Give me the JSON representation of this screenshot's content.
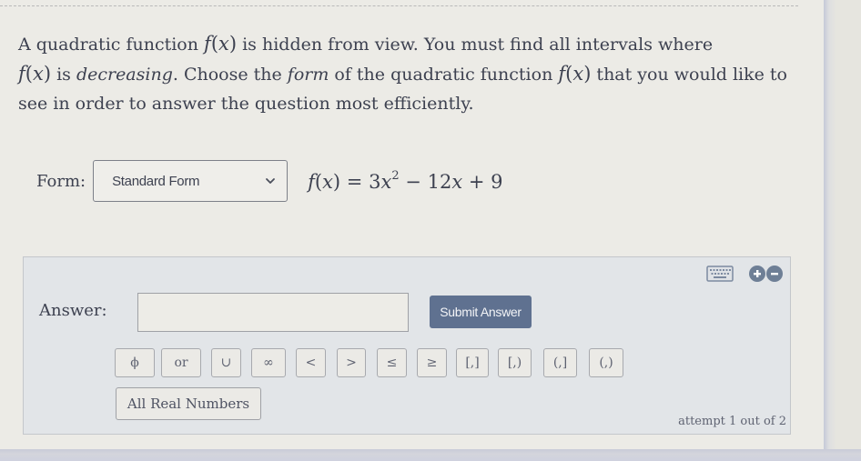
{
  "question": {
    "part1": "A quadratic function ",
    "func": "f",
    "var": "x",
    "part2": " is hidden from view. You must find all intervals where",
    "part3": " is ",
    "emphasis_decreasing": "decreasing",
    "part4": ". Choose the ",
    "emphasis_form": "form",
    "part5": " of the quadratic function ",
    "part6": " that you would like to see in order to answer the question most efficiently."
  },
  "form": {
    "label": "Form:",
    "selected": "Standard Form",
    "equation": {
      "lhs_func": "f",
      "lhs_var": "x",
      "equals": "=",
      "coef_a": "3",
      "var": "x",
      "exponent": "2",
      "op1": "−",
      "coef_b": "12",
      "op2": "+",
      "const": "9"
    }
  },
  "answer_panel": {
    "tools": [
      {
        "name": "keyboard-icon"
      },
      {
        "name": "zoom-in-icon"
      },
      {
        "name": "zoom-out-icon"
      }
    ],
    "label": "Answer:",
    "input_value": "",
    "submit_label": "Submit Answer",
    "symbols": [
      {
        "label": "ϕ",
        "name": "empty-set"
      },
      {
        "label": "or",
        "name": "or"
      },
      {
        "label": "∪",
        "name": "union"
      },
      {
        "label": "∞",
        "name": "infinity"
      },
      {
        "label": "<",
        "name": "less-than"
      },
      {
        "label": ">",
        "name": "greater-than"
      },
      {
        "label": "≤",
        "name": "less-or-equal"
      },
      {
        "label": "≥",
        "name": "greater-or-equal"
      },
      {
        "label": "[,]",
        "name": "closed-interval"
      },
      {
        "label": "[,)",
        "name": "closed-open-interval"
      },
      {
        "label": "(,]",
        "name": "open-closed-interval"
      },
      {
        "label": "(,)",
        "name": "open-interval"
      }
    ],
    "all_real_label": "All Real Numbers",
    "attempt_text": "attempt 1 out of 2"
  },
  "colors": {
    "submit_button": "#5f7190",
    "tool_button": "#6e7f96",
    "panel_bg": "#e2e5e8",
    "page_bg": "#ecebe6"
  }
}
